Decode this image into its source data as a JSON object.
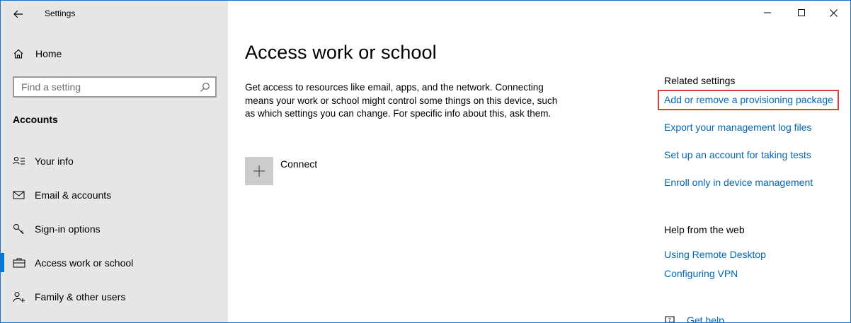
{
  "window": {
    "title": "Settings",
    "accent": "#0078d7",
    "link_color": "#0067b8",
    "highlight_color": "#e03c3c"
  },
  "sidebar": {
    "home_label": "Home",
    "search_placeholder": "Find a setting",
    "section_title": "Accounts",
    "items": [
      {
        "label": "Your info",
        "icon": "person-card-icon",
        "selected": false
      },
      {
        "label": "Email & accounts",
        "icon": "envelope-icon",
        "selected": false
      },
      {
        "label": "Sign-in options",
        "icon": "key-icon",
        "selected": false
      },
      {
        "label": "Access work or school",
        "icon": "briefcase-icon",
        "selected": true
      },
      {
        "label": "Family & other users",
        "icon": "person-add-icon",
        "selected": false
      }
    ]
  },
  "main": {
    "title": "Access work or school",
    "description": "Get access to resources like email, apps, and the network. Connecting means your work or school might control some things on this device, such as which settings you can change. For specific info about this, ask them.",
    "connect_label": "Connect"
  },
  "related": {
    "title": "Related settings",
    "links": [
      "Add or remove a provisioning package",
      "Export your management log files",
      "Set up an account for taking tests",
      "Enroll only in device management"
    ]
  },
  "help": {
    "title": "Help from the web",
    "links": [
      "Using Remote Desktop",
      "Configuring VPN"
    ],
    "get_help_label": "Get help"
  }
}
